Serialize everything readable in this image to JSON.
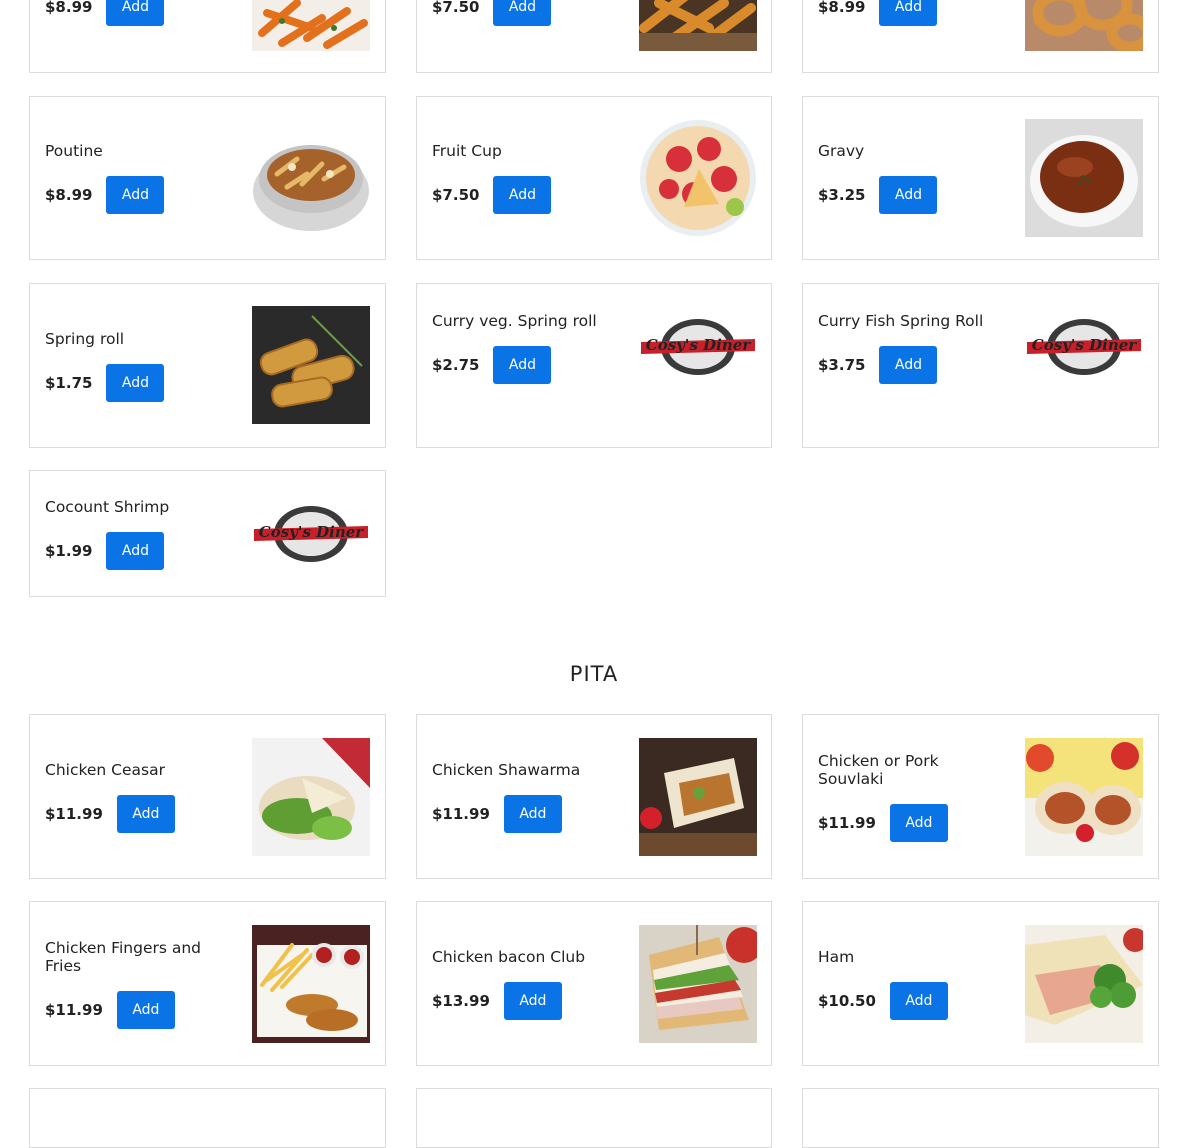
{
  "top_row": [
    {
      "price": "$8.99",
      "add": "Add",
      "image": "sweet-potato-fries-image"
    },
    {
      "price": "$7.50",
      "add": "Add",
      "image": "wedge-fries-image"
    },
    {
      "price": "$8.99",
      "add": "Add",
      "image": "onion-rings-image"
    }
  ],
  "sides": [
    {
      "name": "Poutine",
      "price": "$8.99",
      "add": "Add",
      "image": "poutine-image"
    },
    {
      "name": "Fruit Cup",
      "price": "$7.50",
      "add": "Add",
      "image": "fruit-cup-image"
    },
    {
      "name": "Gravy",
      "price": "$3.25",
      "add": "Add",
      "image": "gravy-image"
    },
    {
      "name": "Spring roll",
      "price": "$1.75",
      "add": "Add",
      "image": "spring-roll-image"
    },
    {
      "name": "Curry veg. Spring roll",
      "price": "$2.75",
      "add": "Add",
      "image": "cosys-diner-logo"
    },
    {
      "name": "Curry Fish Spring Roll",
      "price": "$3.75",
      "add": "Add",
      "image": "cosys-diner-logo"
    },
    {
      "name": "Cocount Shrimp",
      "price": "$1.99",
      "add": "Add",
      "image": "cosys-diner-logo"
    }
  ],
  "pita": {
    "title": "PITA",
    "items": [
      {
        "name": "Chicken Ceasar",
        "price": "$11.99",
        "add": "Add",
        "image": "chicken-ceasar-image"
      },
      {
        "name": "Chicken Shawarma",
        "price": "$11.99",
        "add": "Add",
        "image": "chicken-shawarma-image"
      },
      {
        "name": "Chicken or Pork Souvlaki",
        "price": "$11.99",
        "add": "Add",
        "image": "souvlaki-image"
      },
      {
        "name": "Chicken Fingers and Fries",
        "price": "$11.99",
        "add": "Add",
        "image": "chicken-fingers-image"
      },
      {
        "name": "Chicken bacon Club",
        "price": "$13.99",
        "add": "Add",
        "image": "club-sandwich-image"
      },
      {
        "name": "Ham",
        "price": "$10.50",
        "add": "Add",
        "image": "ham-wrap-image"
      }
    ]
  },
  "logo": {
    "text": "Cosy's Diner"
  },
  "colors": {
    "accent": "#0a74e6",
    "border": "#dcdcdc"
  }
}
